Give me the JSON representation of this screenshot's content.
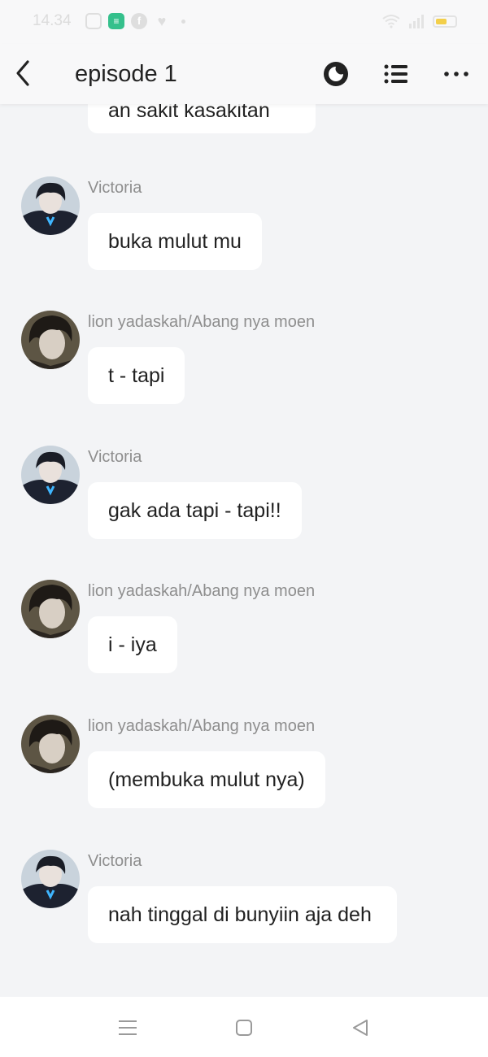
{
  "status_bar": {
    "time": "14.34",
    "icons": [
      "instagram-icon",
      "app-notification-icon",
      "facebook-icon",
      "heart-icon",
      "dot-icon",
      "wifi-icon",
      "signal-icon",
      "battery-icon"
    ],
    "app_icon_glyph": "≡",
    "facebook_glyph": "f",
    "heart_glyph": "♥",
    "battery_level": 0.6,
    "battery_color": "#f3cf4a"
  },
  "header": {
    "title": "episode 1",
    "icons": [
      "back-arrow-icon",
      "theme-toggle-icon",
      "list-icon",
      "more-dots-icon"
    ]
  },
  "messages": [
    {
      "text": "an sakit  kasakitan",
      "partial": true
    },
    {
      "sender": "Victoria",
      "avatar": "victoria-avatar",
      "text": "buka mulut mu"
    },
    {
      "sender": "lion yadaskah/Abang nya moen",
      "avatar": "lion-avatar",
      "text": "t - tapi"
    },
    {
      "sender": "Victoria",
      "avatar": "victoria-avatar",
      "text": "gak ada tapi - tapi!!"
    },
    {
      "sender": "lion yadaskah/Abang nya moen",
      "avatar": "lion-avatar",
      "text": "i - iya"
    },
    {
      "sender": "lion yadaskah/Abang nya moen",
      "avatar": "lion-avatar",
      "text": "(membuka mulut nya)"
    },
    {
      "sender": "Victoria",
      "avatar": "victoria-avatar",
      "text": "nah tinggal di bunyiin aja deh"
    }
  ],
  "nav_bar": {
    "icons": [
      "menu-icon",
      "home-square-icon",
      "back-triangle-icon"
    ]
  },
  "colors": {
    "background": "#f3f4f6",
    "bubble": "#ffffff",
    "sender_text": "#8e8e8e",
    "text": "#222222"
  }
}
